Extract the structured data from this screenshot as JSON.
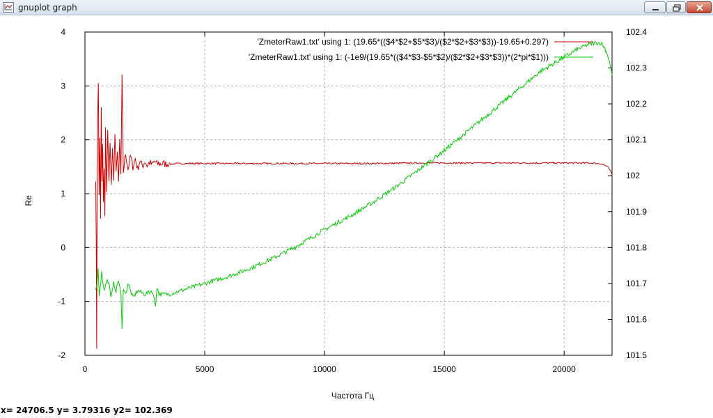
{
  "window": {
    "title": "gnuplot graph"
  },
  "status": {
    "coords": "x= 24706.5 y= 3.79316 y2= 102.369"
  },
  "chart_data": {
    "type": "line",
    "xlabel": "Частота Гц",
    "ylabel": "Re",
    "y2label": "",
    "xlim": [
      0,
      22000
    ],
    "ylim": [
      -2,
      4
    ],
    "y2lim": [
      101.5,
      102.4
    ],
    "xticks": [
      0,
      5000,
      10000,
      15000,
      20000
    ],
    "yticks": [
      -2,
      -1,
      0,
      1,
      2,
      3,
      4
    ],
    "y2ticks": [
      101.5,
      101.6,
      101.7,
      101.8,
      101.9,
      102,
      102.1,
      102.2,
      102.3,
      102.4
    ],
    "grid": true,
    "legend_position": "top-right",
    "series": [
      {
        "name": "'ZmeterRaw1.txt' using 1: (19.65*(($4*$2+$5*$3)/($2*$2+$3*$3))-19.65+0.297)",
        "axis": "y",
        "color": "#cc0000",
        "x": [
          450,
          470,
          490,
          510,
          530,
          560,
          590,
          620,
          650,
          680,
          710,
          740,
          770,
          800,
          830,
          860,
          900,
          950,
          1000,
          1050,
          1100,
          1150,
          1200,
          1250,
          1300,
          1350,
          1400,
          1450,
          1500,
          1550,
          1600,
          1700,
          1800,
          1900,
          2000,
          2100,
          2200,
          2300,
          2400,
          2500,
          2600,
          2700,
          2800,
          2900,
          3000,
          3200,
          3500,
          4000,
          5000,
          6000,
          8000,
          10000,
          12000,
          14000,
          16000,
          18000,
          20000,
          21000,
          21500,
          21700,
          21850,
          21950,
          22000
        ],
        "y": [
          1.3,
          0.1,
          -1.85,
          1.1,
          2.4,
          3.05,
          1.0,
          2.0,
          0.5,
          2.6,
          1.2,
          1.9,
          0.8,
          1.5,
          0.6,
          2.2,
          1.0,
          2.25,
          1.2,
          1.95,
          1.1,
          1.8,
          1.3,
          2.1,
          1.35,
          1.75,
          1.2,
          2.0,
          1.3,
          3.15,
          1.4,
          1.75,
          1.45,
          1.7,
          1.5,
          1.65,
          1.45,
          1.62,
          1.5,
          1.6,
          1.52,
          1.58,
          1.53,
          1.6,
          1.55,
          1.56,
          1.55,
          1.56,
          1.56,
          1.56,
          1.56,
          1.56,
          1.56,
          1.57,
          1.57,
          1.57,
          1.57,
          1.57,
          1.56,
          1.53,
          1.48,
          1.4,
          1.35
        ]
      },
      {
        "name": "'ZmeterRaw1.txt' using 1: (-1e9/(19.65*(($4*$3-$5*$2)/($2*$2+$3*$3))*(2*pi*$1)))",
        "axis": "y2",
        "color": "#00cc00",
        "x": [
          450,
          500,
          550,
          600,
          700,
          800,
          900,
          1000,
          1100,
          1200,
          1300,
          1400,
          1500,
          1550,
          1600,
          1700,
          1800,
          2000,
          2200,
          2500,
          2800,
          2950,
          3000,
          3100,
          3500,
          4000,
          4500,
          5000,
          6000,
          7000,
          8000,
          9000,
          10000,
          11000,
          12000,
          13000,
          14000,
          15000,
          16000,
          17000,
          18000,
          19000,
          20000,
          20500,
          21000,
          21300,
          21500,
          21600,
          21700,
          21800,
          21900,
          22000
        ],
        "y": [
          101.68,
          101.7,
          101.74,
          101.67,
          101.73,
          101.68,
          101.71,
          101.7,
          101.66,
          101.7,
          101.68,
          101.71,
          101.67,
          101.57,
          101.69,
          101.67,
          101.7,
          101.66,
          101.68,
          101.67,
          101.68,
          101.64,
          101.69,
          101.67,
          101.67,
          101.68,
          101.69,
          101.7,
          101.72,
          101.745,
          101.775,
          101.81,
          101.85,
          101.885,
          101.925,
          101.97,
          102.02,
          102.07,
          102.125,
          102.18,
          102.235,
          102.29,
          102.33,
          102.35,
          102.365,
          102.37,
          102.37,
          102.365,
          102.355,
          102.34,
          102.315,
          102.28
        ]
      }
    ]
  }
}
